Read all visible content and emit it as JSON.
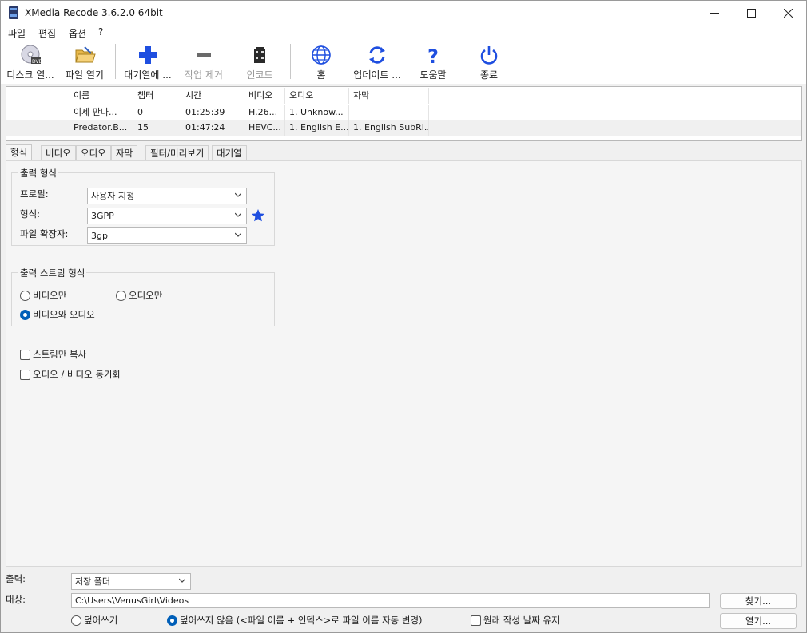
{
  "window": {
    "title": "XMedia Recode 3.6.2.0 64bit"
  },
  "menu": [
    "파일",
    "편집",
    "옵션",
    "?"
  ],
  "toolbar": {
    "disc_open": "디스크 열...",
    "file_open": "파일 열기",
    "add_queue": "대기열에 ...",
    "remove_job": "작업 제거",
    "encode": "인코드",
    "home": "홈",
    "update": "업데이트 ...",
    "help": "도움말",
    "exit": "종료"
  },
  "file_list": {
    "headers": [
      "이름",
      "챕터",
      "시간",
      "비디오",
      "오디오",
      "자막"
    ],
    "rows": [
      {
        "name": "이제 만나...",
        "chapters": "0",
        "time": "01:25:39",
        "video": "H.26...",
        "audio": "1. Unknow...",
        "subtitle": ""
      },
      {
        "name": "Predator.B...",
        "chapters": "15",
        "time": "01:47:24",
        "video": "HEVC...",
        "audio": "1. English E...",
        "subtitle": "1. English SubRi..."
      }
    ]
  },
  "tabs": [
    "형식",
    "비디오",
    "오디오",
    "자막",
    "필터/미리보기",
    "대기열"
  ],
  "format_tab": {
    "output_format_group": "출력 형식",
    "profile_label": "프로필:",
    "profile_value": "사용자 지정",
    "format_label": "형식:",
    "format_value": "3GPP",
    "extension_label": "파일 확장자:",
    "extension_value": "3gp",
    "stream_group": "출력 스트림 형식",
    "video_only": "비디오만",
    "audio_only": "오디오만",
    "video_audio": "비디오와 오디오",
    "copy_streams": "스트림만 복사",
    "av_sync": "오디오 / 비디오 동기화"
  },
  "bottom": {
    "output_label": "출력:",
    "output_value": "저장 폴더",
    "target_label": "대상:",
    "target_path": "C:\\Users\\VenusGirl\\Videos",
    "browse_button": "찾기...",
    "open_button": "열기...",
    "overwrite": "덮어쓰기",
    "no_overwrite": "덮어쓰지 않음 (<파일 이름 + 인덱스>로 파일 이름 자동 변경)",
    "keep_date": "원래 작성 날짜 유지"
  },
  "colors": {
    "accent": "#005fb8",
    "toolbar_blue": "#1f4fe0",
    "selected_row": "#f0f0f0"
  }
}
